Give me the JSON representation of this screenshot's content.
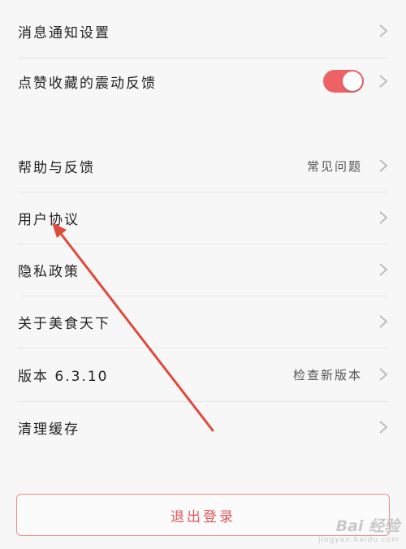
{
  "settings": {
    "items": [
      {
        "label": "消息通知设置",
        "value": ""
      },
      {
        "label": "点赞收藏的震动反馈",
        "value": ""
      },
      {
        "label": "帮助与反馈",
        "value": "常见问题"
      },
      {
        "label": "用户协议",
        "value": ""
      },
      {
        "label": "隐私政策",
        "value": ""
      },
      {
        "label": "关于美食天下",
        "value": ""
      },
      {
        "label": "版本 6.3.10",
        "value": "检查新版本"
      },
      {
        "label": "清理缓存",
        "value": ""
      }
    ],
    "vibration_toggle": {
      "state": "on"
    }
  },
  "logout_label": "退出登录",
  "watermark": {
    "brand": "Bai  经验",
    "sub": "jingyan.baidu.com"
  },
  "colors": {
    "accent": "#ee6266",
    "background": "#f7f7f7"
  },
  "icons": [
    "chevron-right-icon",
    "annotation-arrow-icon"
  ]
}
